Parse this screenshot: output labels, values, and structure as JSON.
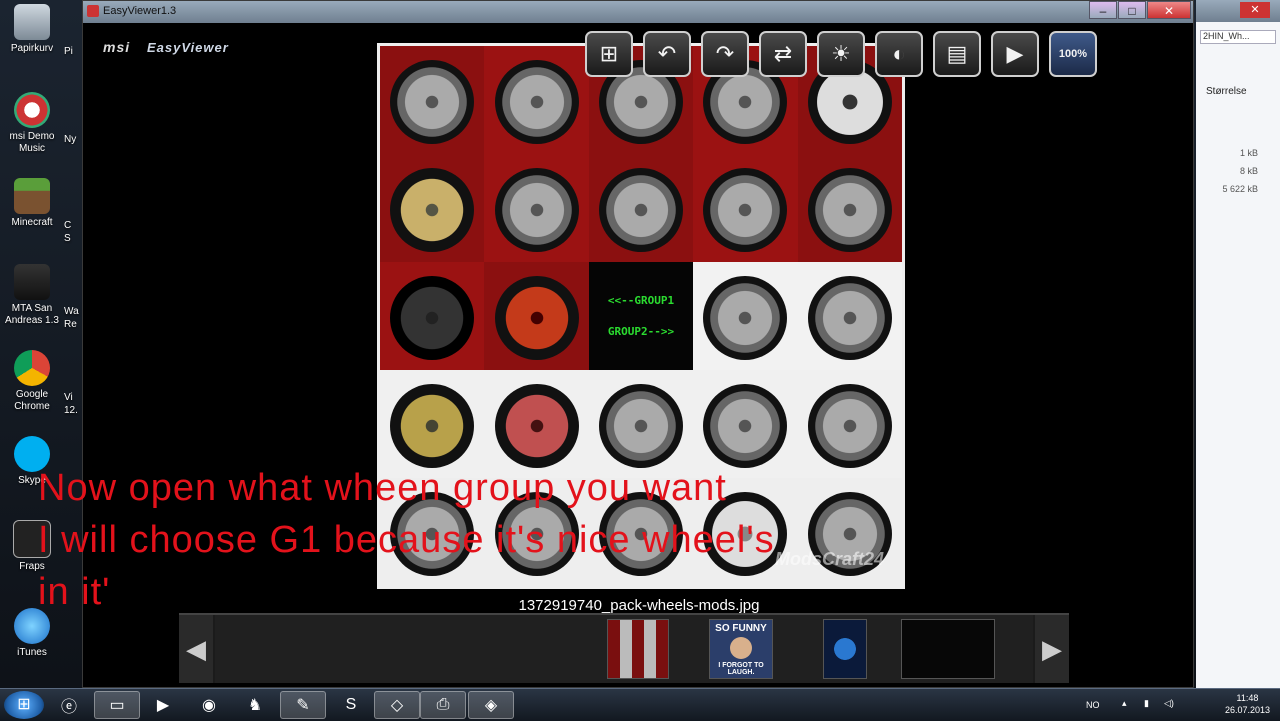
{
  "desktop": {
    "icons": [
      {
        "label": "Papirkurv"
      },
      {
        "label": "msi Demo Music"
      },
      {
        "label": "Minecraft"
      },
      {
        "label": "MTA San Andreas 1.3"
      },
      {
        "label": "Google Chrome"
      },
      {
        "label": "Skype"
      },
      {
        "label": "Fraps"
      },
      {
        "label": "iTunes"
      }
    ],
    "partial_labels": [
      "Pi",
      "Ny",
      "C",
      "S",
      "Wa",
      "Re",
      "Vi",
      "12."
    ]
  },
  "viewer": {
    "title": "EasyViewer1.3",
    "logo_msi": "msi",
    "logo_brand": "EasyViewer",
    "zoom_label": "100%",
    "filename": "1372919740_pack-wheels-mods.jpg",
    "image_text": {
      "group1": "<<--GROUP1",
      "group2": "GROUP2-->>",
      "watermark": "ModsCraft24"
    },
    "thumb_joke": {
      "top": "SO FUNNY",
      "bottom": "I FORGOT TO LAUGH."
    }
  },
  "caption": {
    "line1": "Now open what wheen group you want",
    "line2": "I will choose G1 because it's nice wheel's",
    "line3": "in it'"
  },
  "explorer": {
    "path": "2HIN_Wh...",
    "column": "Størrelse",
    "sizes": [
      "1 kB",
      "8 kB",
      "5 622 kB"
    ]
  },
  "taskbar": {
    "language": "NO",
    "time": "11:48",
    "date": "26.07.2013"
  },
  "colors": {
    "caption_red": "#e3121b",
    "group_green": "#2bdc30"
  }
}
